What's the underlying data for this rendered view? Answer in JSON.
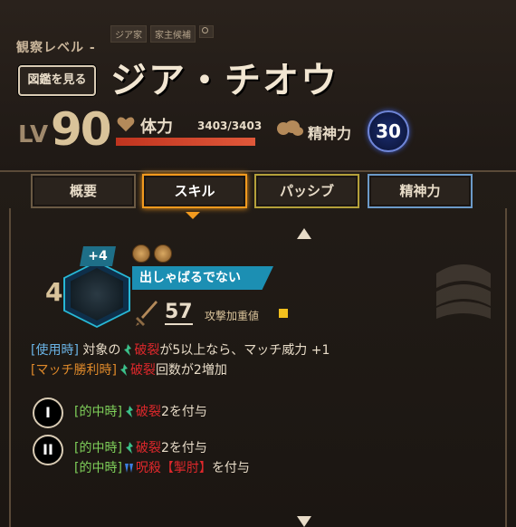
{
  "header": {
    "observe_label": "観察レベル -",
    "dex_button": "図鑑を見る",
    "tags": [
      "ジア家",
      "家主候補"
    ],
    "name": "ジア・チオウ",
    "lv_label": "LV",
    "lv_value": "90"
  },
  "stats": {
    "hp_label": "体力",
    "hp_value": "3403/3403",
    "hp_fraction": 1.0,
    "mind_label": "精神力",
    "mind_value": "30"
  },
  "tabs": [
    {
      "label": "概要",
      "active": false
    },
    {
      "label": "スキル",
      "active": true
    },
    {
      "label": "パッシブ",
      "active": false
    },
    {
      "label": "精神力",
      "active": false
    }
  ],
  "skill": {
    "level": "4",
    "plus": "+4",
    "name": "出しゃばるでない",
    "power": "57",
    "atk_weight_label": "攻撃加重値"
  },
  "effects": {
    "on_use_tag": "[使用時]",
    "on_use_prefix": "対象の",
    "on_use_keyword": "破裂",
    "on_use_suffix": "が5以上なら、マッチ威力 +1",
    "clash_win_tag": "[マッチ勝利時]",
    "clash_win_keyword": "破裂",
    "clash_win_suffix": "回数が2増加"
  },
  "coin_effects": [
    {
      "numeral": "I",
      "lines": [
        {
          "tag": "[的中時]",
          "keyword": "破裂",
          "suffix": "2を付与"
        }
      ]
    },
    {
      "numeral": "II",
      "lines": [
        {
          "tag": "[的中時]",
          "keyword": "破裂",
          "suffix": "2を付与"
        },
        {
          "tag": "[的中時]",
          "keyword": "呪殺【掣肘】",
          "suffix": "を付与"
        }
      ]
    }
  ],
  "colors": {
    "accent_skill": "#f29a1e",
    "tag_blue": "#6ab4e6",
    "tag_orange": "#e08a2a",
    "tag_green": "#7fd05a",
    "keyword_red": "#e0282c",
    "skill_name_bg": "#1c8fb3"
  },
  "icons": [
    "magnifier-icon",
    "heart-icon",
    "brain-icon",
    "sword-icon",
    "rupture-icon",
    "curse-icon",
    "coin-icon",
    "scroll-up-arrow-icon",
    "scroll-down-arrow-icon"
  ]
}
